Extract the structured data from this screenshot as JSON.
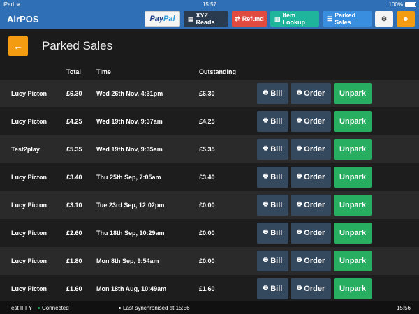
{
  "statusbar": {
    "device": "iPad",
    "time": "15:57",
    "battery": "100%"
  },
  "nav": {
    "brand": "AirPOS",
    "paypal_a": "Pay",
    "paypal_b": "Pal",
    "xyz": "XYZ Reads",
    "refund": "Refund",
    "lookup": "Item Lookup",
    "parked": "Parked Sales",
    "gear_glyph": "⚙",
    "user_glyph": "👤"
  },
  "page": {
    "back_glyph": "←",
    "title": "Parked Sales"
  },
  "columns": {
    "total": "Total",
    "time": "Time",
    "outstanding": "Outstanding"
  },
  "rows": [
    {
      "name": "Lucy Picton",
      "total": "£6.30",
      "time": "Wed 26th Nov, 4:31pm",
      "outstanding": "£6.30"
    },
    {
      "name": "Lucy Picton",
      "total": "£4.25",
      "time": "Wed 19th Nov, 9:37am",
      "outstanding": "£4.25"
    },
    {
      "name": "Test2play",
      "total": "£5.35",
      "time": "Wed 19th Nov, 9:35am",
      "outstanding": "£5.35"
    },
    {
      "name": "Lucy Picton",
      "total": "£3.40",
      "time": "Thu 25th Sep, 7:05am",
      "outstanding": "£3.40"
    },
    {
      "name": "Lucy Picton",
      "total": "£3.10",
      "time": "Tue 23rd Sep, 12:02pm",
      "outstanding": "£0.00"
    },
    {
      "name": "Lucy Picton",
      "total": "£2.60",
      "time": "Thu 18th Sep, 10:29am",
      "outstanding": "£0.00"
    },
    {
      "name": "Lucy Picton",
      "total": "£1.80",
      "time": "Mon 8th Sep, 9:54am",
      "outstanding": "£0.00"
    },
    {
      "name": "Lucy Picton",
      "total": "£1.60",
      "time": "Mon 18th Aug, 10:49am",
      "outstanding": "£1.60"
    }
  ],
  "row_actions": {
    "bill": "Bill",
    "order": "Order",
    "unpark": "Unpark"
  },
  "footer": {
    "store": "Test IFFY",
    "connection": "Connected",
    "sync": "Last synchronised at 15:56",
    "clock": "15:56"
  },
  "colors": {
    "nav": "#2f6fb5",
    "accent": "#f39c12",
    "unpark": "#27ae60",
    "refund": "#e04a3f",
    "lookup": "#1fb59c"
  },
  "icons": {
    "print": "printer-icon",
    "back": "arrow-left-icon",
    "settings": "gear-icon",
    "user": "user-icon",
    "xyz": "report-icon",
    "refund": "refund-icon",
    "lookup": "barcode-icon",
    "parked": "parked-icon"
  }
}
